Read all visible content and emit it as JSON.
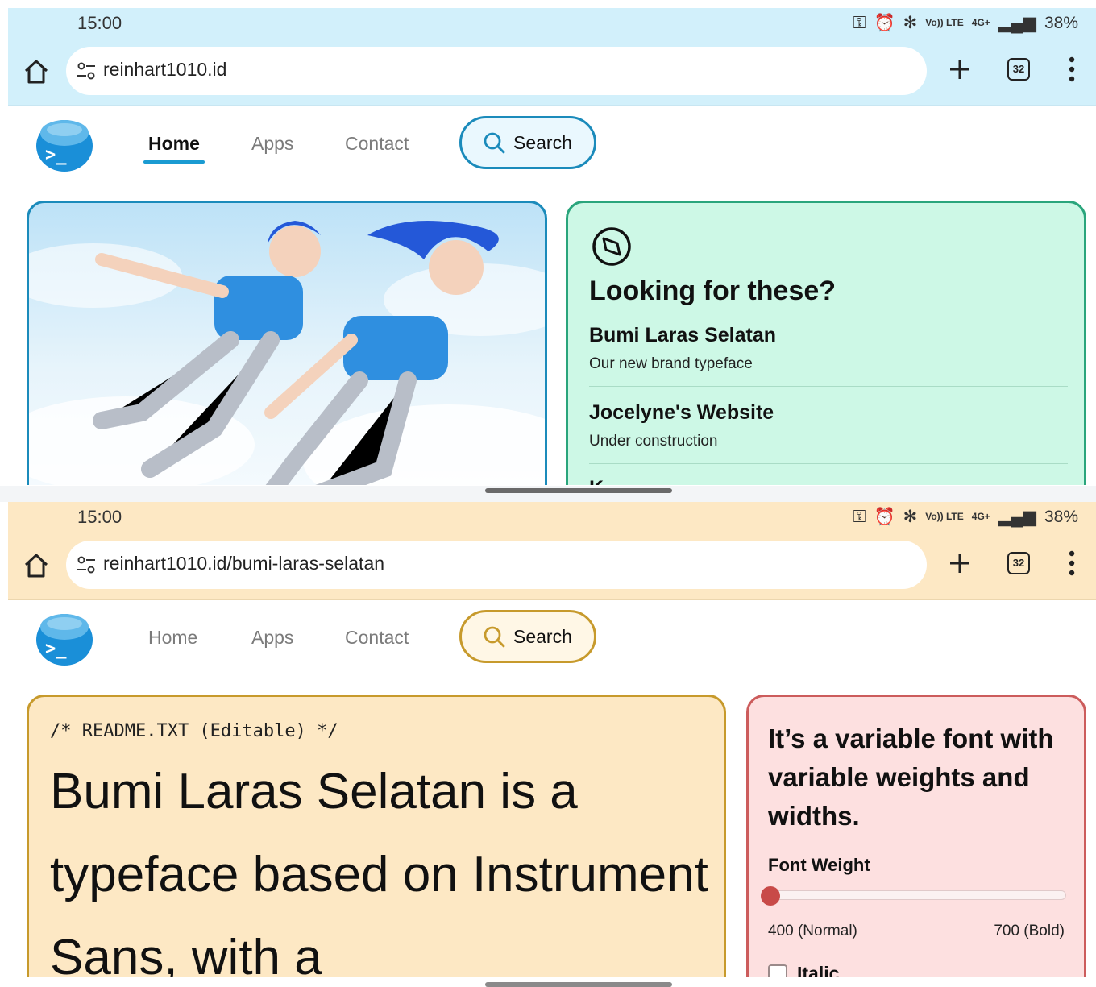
{
  "top": {
    "status": {
      "time": "15:00",
      "battery": "38%",
      "signal_label_1": "Vo)) LTE",
      "signal_label_2": "4G+"
    },
    "browser": {
      "url": "reinhart1010.id",
      "tab_count": "32",
      "chrome_color": "#d2f0fb"
    },
    "nav": {
      "home": "Home",
      "apps": "Apps",
      "contact": "Contact",
      "search": "Search",
      "active": "Home"
    },
    "look": {
      "title": "Looking for these?",
      "items": [
        {
          "title": "Bumi Laras Selatan",
          "subtitle": "Our new brand typeface"
        },
        {
          "title": "Jocelyne's Website",
          "subtitle": "Under construction"
        },
        {
          "title": "K"
        }
      ]
    }
  },
  "bottom": {
    "status": {
      "time": "15:00",
      "battery": "38%",
      "signal_label_1": "Vo)) LTE",
      "signal_label_2": "4G+"
    },
    "browser": {
      "url": "reinhart1010.id/bumi-laras-selatan",
      "tab_count": "32",
      "chrome_color": "#fde8c4"
    },
    "nav": {
      "home": "Home",
      "apps": "Apps",
      "contact": "Contact",
      "search": "Search"
    },
    "readme": {
      "heading": "/* README.TXT (Editable) */",
      "body": "Bumi Laras Selatan is a typeface based on Instrument Sans, with a"
    },
    "variable": {
      "title": "It’s a variable font with variable weights and widths.",
      "font_weight_label": "Font Weight",
      "min_label": "400 (Normal)",
      "max_label": "700 (Bold)",
      "weight_fraction": 0.0,
      "italic_label": "Italic",
      "italic_checked": false
    }
  }
}
